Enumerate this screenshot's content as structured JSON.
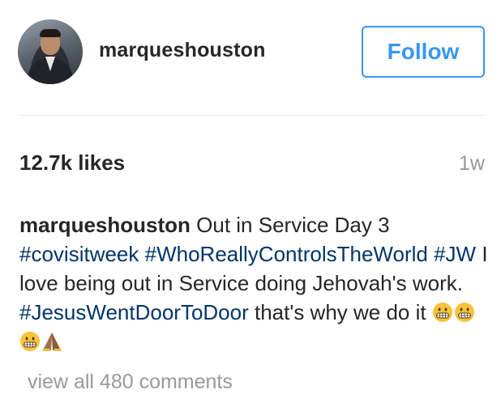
{
  "header": {
    "username": "marqueshouston",
    "follow_label": "Follow",
    "avatar_icon": "profile-photo"
  },
  "stats": {
    "likes": "12.7k likes",
    "time_ago": "1w"
  },
  "caption": {
    "username": "marqueshouston",
    "text1": " Out in Service Day 3 ",
    "tag1": "#covisitweek",
    "sep1": " ",
    "tag2": "#WhoReallyControlsTheWorld",
    "sep2": " ",
    "tag3": "#JW",
    "text2": " I love being out in Service doing Jehovah's work. ",
    "tag4": "#JesusWentDoorToDoor",
    "text3": " that's why we do it ",
    "emojis": [
      "grimacing-face-icon",
      "grimacing-face-icon",
      "grimacing-face-icon",
      "folded-hands-icon"
    ]
  },
  "comments": {
    "label": "view all 480 comments"
  },
  "colors": {
    "accent": "#3897f0",
    "hashtag": "#003569",
    "muted": "#999999",
    "text": "#262626"
  }
}
